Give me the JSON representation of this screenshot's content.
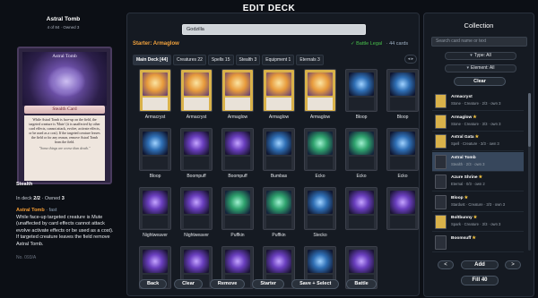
{
  "header": {
    "title": "EDIT DECK"
  },
  "preview": {
    "name": "Astral Tomb",
    "subtitle": "4 of 84 · Owned 3",
    "card_art_title": "Astral Tomb",
    "card_type": "Stealth Card",
    "card_text": "While Astral Tomb is face-up on the field, the targeted creature is 'Mute' (it is unaffected by other card effects, cannot attack, evolve, activate effects, or be used as a cost). If the targeted creature leaves the field or for any reason, remove Astral Tomb from the field.",
    "card_flavor": "\"Some things are worse than death.\"",
    "category": "Stealth",
    "in_deck_label": "In deck",
    "in_deck_value": "2/2",
    "owned_label": "· Owned",
    "owned_value": "3",
    "ability_name": "Astral Tomb",
    "ability_speed": "· fast",
    "ability_text": "While face-up targeted creature is Mute (unaffected by card effects cannot attack evolve activate effects or be used as a cost). If targeted creature leaves the field remove Astral Tomb.",
    "card_no": "No. 093/A"
  },
  "deck": {
    "search_value": "Godzilla",
    "starter_label": "Starter: Armaglow",
    "legal_label": "✓ Battle Legal",
    "count_label": "· 44 cards",
    "tabs": [
      {
        "label": "Main Deck [44]"
      },
      {
        "label": "Creatures 22"
      },
      {
        "label": "Spells 15"
      },
      {
        "label": "Stealth 3"
      },
      {
        "label": "Equipment 1"
      },
      {
        "label": "Eternals 3"
      }
    ],
    "tabs_arrows": "◂ ▸",
    "cards": [
      {
        "name": "Armacryst",
        "style": "c-gold"
      },
      {
        "name": "Armacryst",
        "style": "c-gold"
      },
      {
        "name": "Armaglow",
        "style": "c-gold"
      },
      {
        "name": "Armaglow",
        "style": "c-gold"
      },
      {
        "name": "Armaglow",
        "style": "c-gold"
      },
      {
        "name": "Bloop",
        "style": "c-dark"
      },
      {
        "name": "Bloop",
        "style": "c-dark"
      },
      {
        "name": "Bloop",
        "style": "c-dark"
      },
      {
        "name": "Boompuff",
        "style": "c-purple"
      },
      {
        "name": "Boompuff",
        "style": "c-purple"
      },
      {
        "name": "Bumbas",
        "style": "c-dark"
      },
      {
        "name": "Ecko",
        "style": "c-green"
      },
      {
        "name": "Ecko",
        "style": "c-green"
      },
      {
        "name": "Ecko",
        "style": "c-dark"
      },
      {
        "name": "Nightweaver",
        "style": "c-purple"
      },
      {
        "name": "Nightweaver",
        "style": "c-purple"
      },
      {
        "name": "Puffkin",
        "style": "c-green"
      },
      {
        "name": "Puffkin",
        "style": "c-green"
      },
      {
        "name": "Stecko",
        "style": "c-dark"
      },
      {
        "name": "",
        "style": "c-purple"
      },
      {
        "name": "",
        "style": "c-purple"
      },
      {
        "name": "",
        "style": "c-purple"
      },
      {
        "name": "",
        "style": "c-purple"
      },
      {
        "name": "",
        "style": "c-purple"
      },
      {
        "name": "",
        "style": "c-purple"
      },
      {
        "name": "",
        "style": "c-dark"
      },
      {
        "name": "",
        "style": "c-purple"
      }
    ],
    "buttons": {
      "back": "Back",
      "clear": "Clear",
      "remove": "Remove",
      "starter": "Starter",
      "save_select": "Save + Select",
      "battle": "Battle"
    }
  },
  "collection": {
    "title": "Collection",
    "search_placeholder": "Search card name or text",
    "type_filter": "Type: All",
    "element_filter": "Element: All",
    "clear": "Clear",
    "items": [
      {
        "name": "Armacryst",
        "star": "",
        "meta": "Stone · Creature · 2/3 · own 3",
        "selected": false,
        "style": "c-gold"
      },
      {
        "name": "Armaglow",
        "star": "★",
        "meta": "Stone · Creature · 3/3 · own 3",
        "selected": false,
        "style": "c-gold"
      },
      {
        "name": "Astral Gata",
        "star": "★",
        "meta": "Spell · Creature · 3/3 · own 3",
        "selected": false,
        "style": "c-gold"
      },
      {
        "name": "Astral Tomb",
        "star": "",
        "meta": "Stealth · 2/3 · own 3",
        "selected": true,
        "style": "c-purple"
      },
      {
        "name": "Azure Shrine",
        "star": "★",
        "meta": "Eternal · 0/3 · own 2",
        "selected": false,
        "style": "c-dark"
      },
      {
        "name": "Bloop",
        "star": "★",
        "meta": "Stardust · Creature · 3/3 · own 3",
        "selected": false,
        "style": "c-dark"
      },
      {
        "name": "Boltbunny",
        "star": "★",
        "meta": "Spark · Creature · 3/3 · own 3",
        "selected": false,
        "style": "c-gold"
      },
      {
        "name": "Boomsuff",
        "star": "★",
        "meta": "",
        "selected": false,
        "style": "c-purple"
      }
    ],
    "prev": "<",
    "next": ">",
    "add": "Add",
    "fill": "Fill 40"
  }
}
